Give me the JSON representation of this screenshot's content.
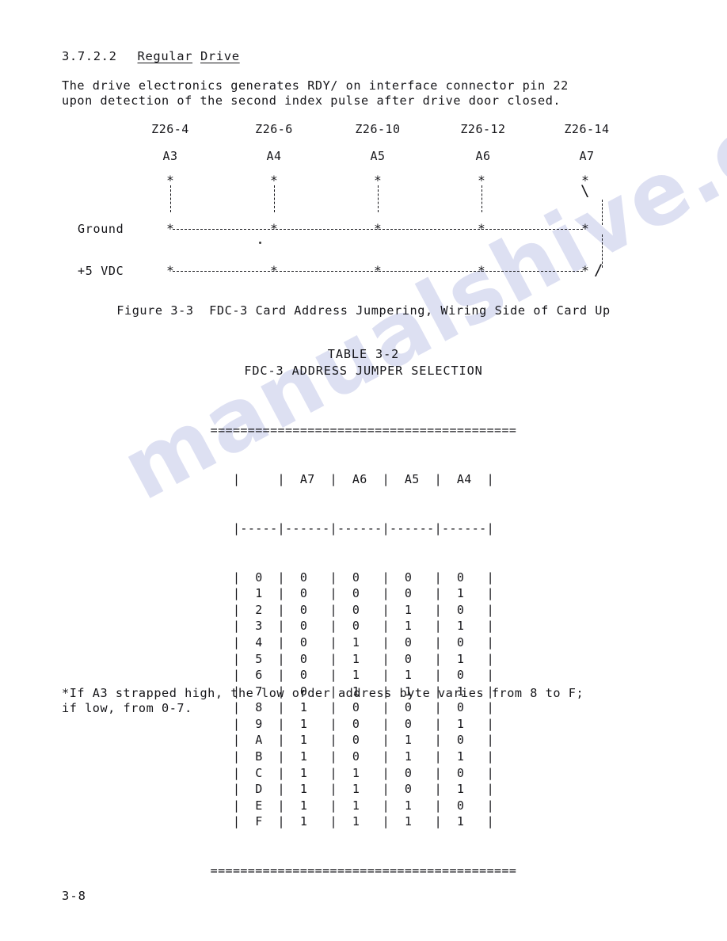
{
  "watermark": {
    "text": "manualshive.com"
  },
  "section": {
    "number": "3.7.2.2",
    "title_word1": "Regular",
    "title_word2": "Drive"
  },
  "paragraph": {
    "line1": "The drive electronics generates RDY/ on interface connector pin 22",
    "line2": "upon detection of the second index pulse after drive door closed."
  },
  "figure": {
    "pin_labels": [
      "Z26-4",
      "Z26-6",
      "Z26-10",
      "Z26-12",
      "Z26-14"
    ],
    "address_labels": [
      "A3",
      "A4",
      "A5",
      "A6",
      "A7"
    ],
    "row_label_ground": "Ground",
    "row_label_vcc": "+5 VDC",
    "star_glyph": "*",
    "slash_glyph": "\\",
    "slash_glyph_end": "/",
    "caption": "Figure 3-3  FDC-3 Card Address Jumpering, Wiring Side of Card Up"
  },
  "table": {
    "title_line1": "TABLE 3-2",
    "title_line2": "FDC-3 ADDRESS JUMPER SELECTION",
    "border_top": "=========================================",
    "border_bottom": "=========================================",
    "header_row": "|     |  A7  |  A6  |  A5  |  A4  |",
    "separator_row": "|-----|------|------|------|------|",
    "columns": [
      "",
      "A7",
      "A6",
      "A5",
      "A4"
    ],
    "rows": [
      {
        "address": "0",
        "A7": "0",
        "A6": "0",
        "A5": "0",
        "A4": "0"
      },
      {
        "address": "1",
        "A7": "0",
        "A6": "0",
        "A5": "0",
        "A4": "1"
      },
      {
        "address": "2",
        "A7": "0",
        "A6": "0",
        "A5": "1",
        "A4": "0"
      },
      {
        "address": "3",
        "A7": "0",
        "A6": "0",
        "A5": "1",
        "A4": "1"
      },
      {
        "address": "4",
        "A7": "0",
        "A6": "1",
        "A5": "0",
        "A4": "0"
      },
      {
        "address": "5",
        "A7": "0",
        "A6": "1",
        "A5": "0",
        "A4": "1"
      },
      {
        "address": "6",
        "A7": "0",
        "A6": "1",
        "A5": "1",
        "A4": "0"
      },
      {
        "address": "7",
        "A7": "0",
        "A6": "1",
        "A5": "1",
        "A4": "1"
      },
      {
        "address": "8",
        "A7": "1",
        "A6": "0",
        "A5": "0",
        "A4": "0"
      },
      {
        "address": "9",
        "A7": "1",
        "A6": "0",
        "A5": "0",
        "A4": "1"
      },
      {
        "address": "A",
        "A7": "1",
        "A6": "0",
        "A5": "1",
        "A4": "0"
      },
      {
        "address": "B",
        "A7": "1",
        "A6": "0",
        "A5": "1",
        "A4": "1"
      },
      {
        "address": "C",
        "A7": "1",
        "A6": "1",
        "A5": "0",
        "A4": "0"
      },
      {
        "address": "D",
        "A7": "1",
        "A6": "1",
        "A5": "0",
        "A4": "1"
      },
      {
        "address": "E",
        "A7": "1",
        "A6": "1",
        "A5": "1",
        "A4": "0"
      },
      {
        "address": "F",
        "A7": "1",
        "A6": "1",
        "A5": "1",
        "A4": "1"
      }
    ]
  },
  "footnote": {
    "line1": "*If A3 strapped high, the low order address byte varies from 8 to F;",
    "line2": "if low, from 0-7."
  },
  "page_number": "3-8"
}
